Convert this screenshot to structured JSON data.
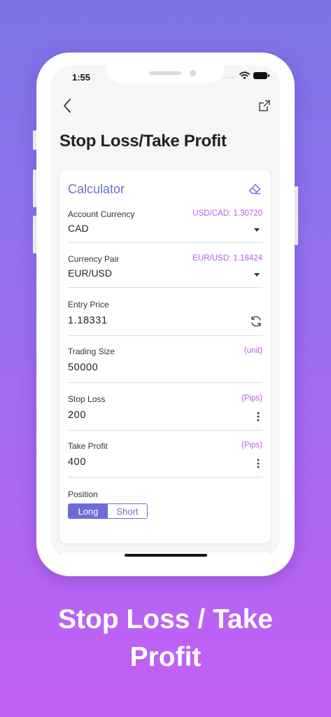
{
  "status_bar": {
    "time": "1:55",
    "signal_dots": "....",
    "wifi_icon": "wifi-icon",
    "battery_icon": "battery-icon"
  },
  "nav": {
    "back_icon": "chevron-left-icon",
    "share_icon": "external-link-icon"
  },
  "page": {
    "title": "Stop Loss/Take Profit"
  },
  "calculator": {
    "title": "Calculator",
    "clear_icon": "eraser-icon",
    "fields": {
      "account_currency": {
        "label": "Account Currency",
        "extra": "USD/CAD: 1.30720",
        "value": "CAD"
      },
      "currency_pair": {
        "label": "Currency Pair",
        "extra": "EUR/USD: 1.18424",
        "value": "EUR/USD"
      },
      "entry_price": {
        "label": "Entry Price",
        "value": "1.18331"
      },
      "trading_size": {
        "label": "Trading Size",
        "extra": "(unit)",
        "value": "50000"
      },
      "stop_loss": {
        "label": "Stop Loss",
        "extra": "(Pips)",
        "value": "200"
      },
      "take_profit": {
        "label": "Take Profit",
        "extra": "(Pips)",
        "value": "400"
      }
    },
    "position": {
      "label": "Position",
      "options": [
        "Long",
        "Short"
      ],
      "selected": "Long"
    }
  },
  "colors": {
    "accent": "#6c6cd8",
    "hint": "#b75de0",
    "background_top": "#7a74e6",
    "background_bottom": "#c35ff5"
  },
  "banner": {
    "line1": "Stop Loss / Take",
    "line2": "Profit"
  }
}
